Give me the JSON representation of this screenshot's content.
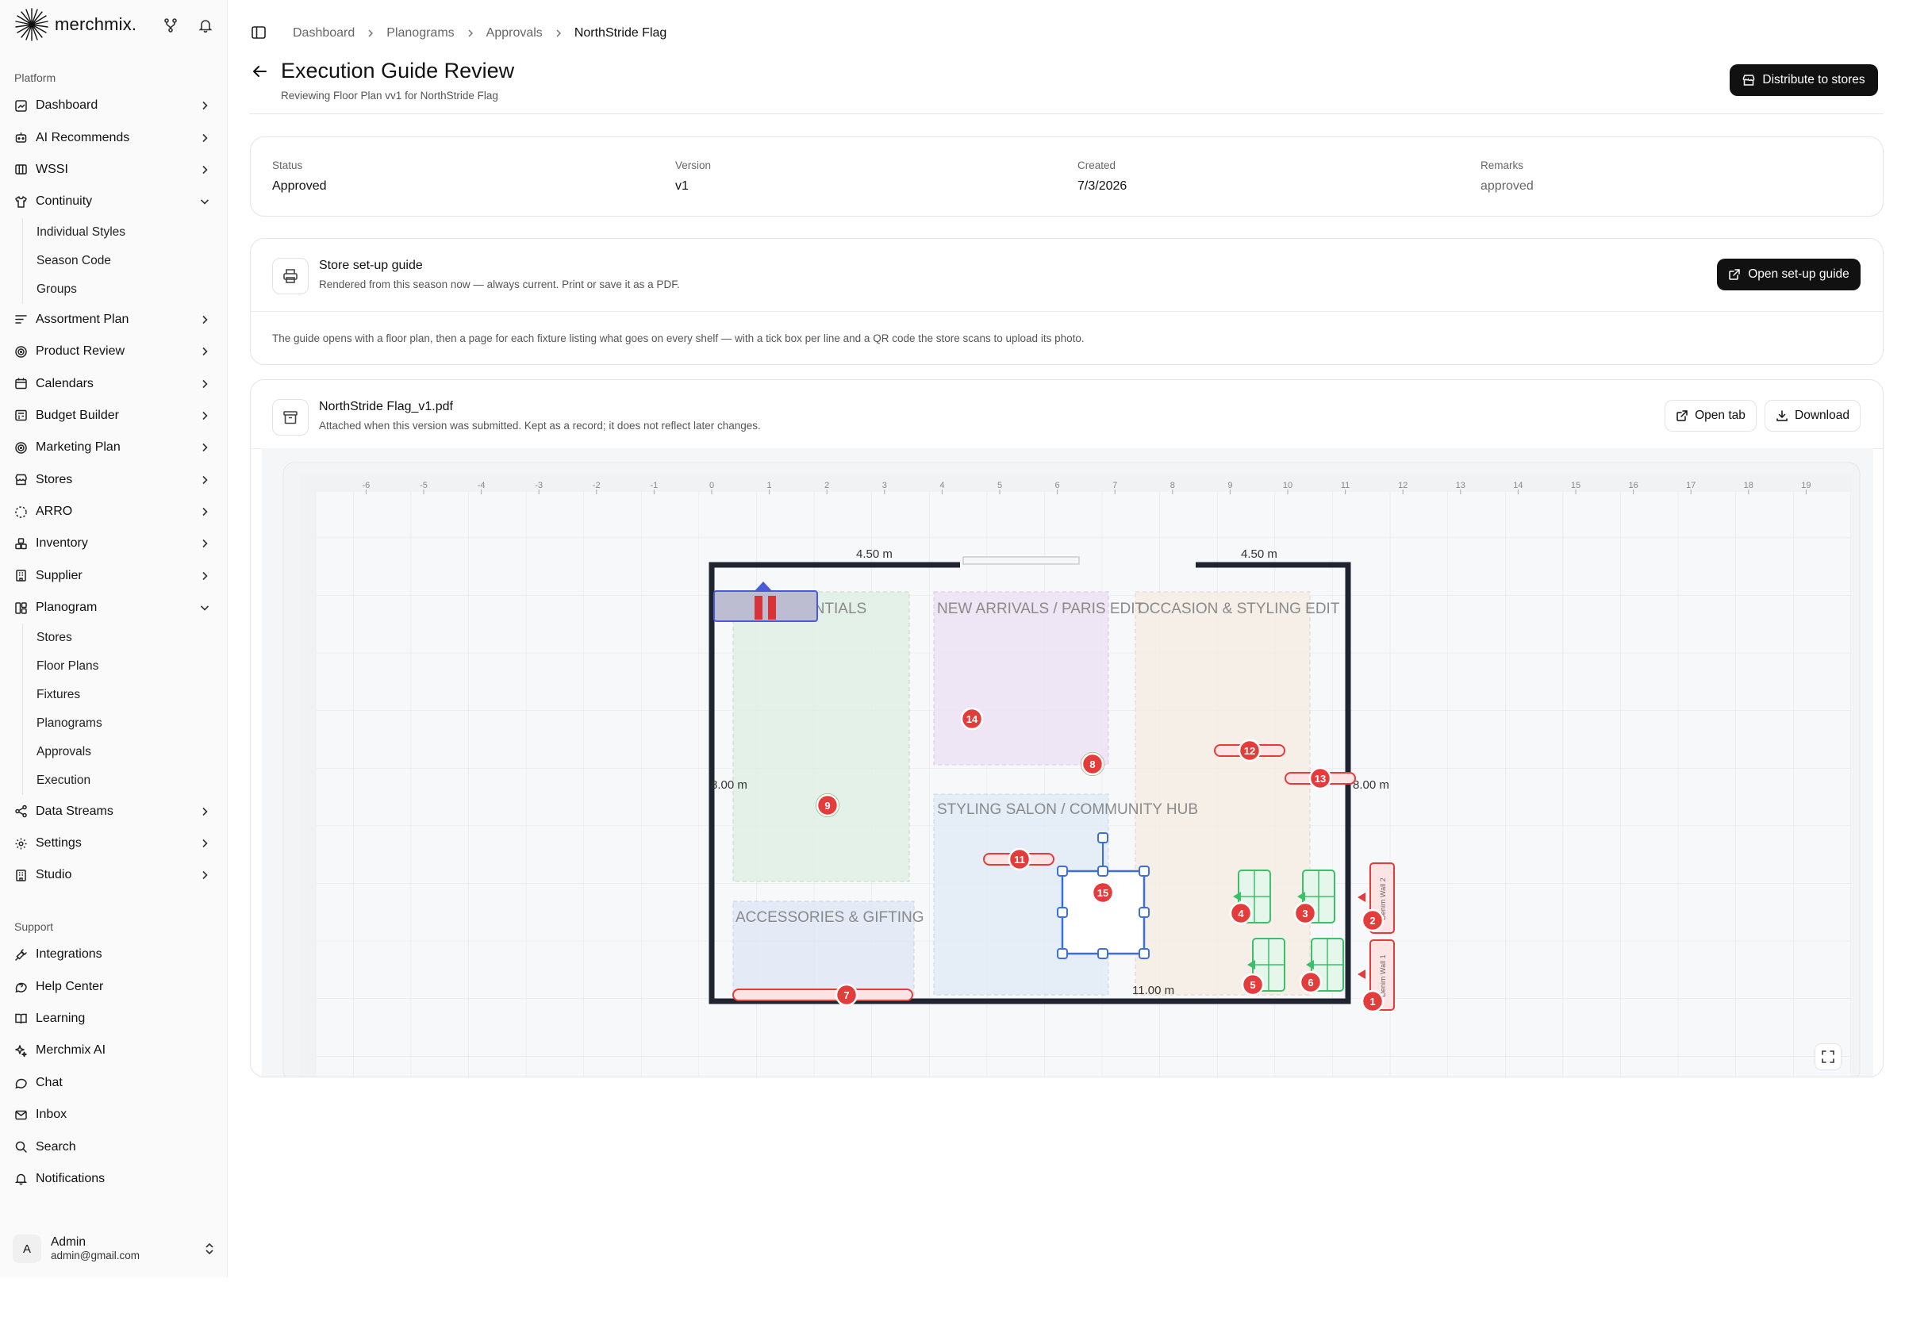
{
  "brand": {
    "name": "merchmix."
  },
  "sidebar": {
    "platform_label": "Platform",
    "items": [
      {
        "label": "Dashboard",
        "icon": "dashboard-icon",
        "expanded": false
      },
      {
        "label": "AI Recommends",
        "icon": "bot-icon",
        "expanded": false
      },
      {
        "label": "WSSI",
        "icon": "columns-icon",
        "expanded": false
      },
      {
        "label": "Continuity",
        "icon": "shirt-icon",
        "expanded": true
      },
      {
        "label": "Assortment Plan",
        "icon": "list-icon",
        "expanded": false
      },
      {
        "label": "Product Review",
        "icon": "target-icon",
        "expanded": false
      },
      {
        "label": "Calendars",
        "icon": "calendar-icon",
        "expanded": false
      },
      {
        "label": "Budget Builder",
        "icon": "calculator-icon",
        "expanded": false
      },
      {
        "label": "Marketing Plan",
        "icon": "target-icon",
        "expanded": false
      },
      {
        "label": "Stores",
        "icon": "store-icon",
        "expanded": false
      },
      {
        "label": "ARRO",
        "icon": "dashed-circle-icon",
        "expanded": false
      },
      {
        "label": "Inventory",
        "icon": "boxes-icon",
        "expanded": false
      },
      {
        "label": "Supplier",
        "icon": "building-icon",
        "expanded": false
      },
      {
        "label": "Planogram",
        "icon": "layout-icon",
        "expanded": true
      },
      {
        "label": "Data Streams",
        "icon": "share-icon",
        "expanded": false
      },
      {
        "label": "Settings",
        "icon": "gear-icon",
        "expanded": false
      },
      {
        "label": "Studio",
        "icon": "building-icon",
        "expanded": false
      }
    ],
    "continuity_children": [
      "Individual Styles",
      "Season Code",
      "Groups"
    ],
    "planogram_children": [
      "Stores",
      "Floor Plans",
      "Fixtures",
      "Planograms",
      "Approvals",
      "Execution"
    ],
    "support_label": "Support",
    "support_items": [
      {
        "label": "Integrations",
        "icon": "plug-icon"
      },
      {
        "label": "Help Center",
        "icon": "help-icon"
      },
      {
        "label": "Learning",
        "icon": "book-icon"
      },
      {
        "label": "Merchmix AI",
        "icon": "sparkle-icon"
      },
      {
        "label": "Chat",
        "icon": "chat-icon"
      },
      {
        "label": "Inbox",
        "icon": "mail-icon"
      },
      {
        "label": "Search",
        "icon": "search-icon"
      },
      {
        "label": "Notifications",
        "icon": "bell-icon"
      }
    ],
    "user": {
      "initial": "A",
      "name": "Admin",
      "email": "admin@gmail.com"
    }
  },
  "breadcrumb": [
    "Dashboard",
    "Planograms",
    "Approvals",
    "NorthStride Flag"
  ],
  "header": {
    "title": "Execution Guide Review",
    "subtitle": "Reviewing Floor Plan vv1 for NorthStride Flag",
    "distribute_label": "Distribute to stores"
  },
  "summary": {
    "status_label": "Status",
    "status": "Approved",
    "version_label": "Version",
    "version": "v1",
    "created_label": "Created",
    "created": "7/3/2026",
    "remarks_label": "Remarks",
    "remarks": "approved"
  },
  "guide": {
    "title": "Store set-up guide",
    "subtitle": "Rendered from this season now — always current. Print or save it as a PDF.",
    "open_label": "Open set-up guide",
    "note": "The guide opens with a floor plan, then a page for each fixture listing what goes on every shelf — with a tick box per line and a QR code the store scans to upload its photo."
  },
  "attachment": {
    "filename": "NorthStride Flag_v1.pdf",
    "subtitle": "Attached when this version was submitted. Kept as a record; it does not reflect later changes.",
    "open_tab_label": "Open tab",
    "download_label": "Download"
  },
  "floorplan": {
    "ruler": [
      "-6",
      "-5",
      "-4",
      "-3",
      "-2",
      "-1",
      "0",
      "1",
      "2",
      "3",
      "4",
      "5",
      "6",
      "7",
      "8",
      "9",
      "10",
      "11",
      "12",
      "13",
      "14",
      "15",
      "16",
      "17",
      "18",
      "19"
    ],
    "dimensions": {
      "top_left": "4.50 m",
      "top_right": "4.50 m",
      "left": "8.00 m",
      "right": "8.00 m",
      "bottom": "11.00 m"
    },
    "zones": [
      "ESSENTIALS",
      "NEW ARRIVALS / PARIS EDIT",
      "OCCASION & STYLING EDIT",
      "STYLING SALON / COMMUNITY HUB",
      "ACCESSORIES & GIFTING"
    ],
    "markers": [
      "1",
      "2",
      "3",
      "4",
      "5",
      "6",
      "7",
      "8",
      "9",
      "11",
      "12",
      "13",
      "14",
      "15"
    ],
    "fixture_labels": [
      "Denim Wall 2",
      "Denim Wall 1"
    ],
    "colors": {
      "marker": "#e43b3b",
      "selection": "#3b6fe0",
      "wall": "#1f2430",
      "fixture_green": "#3cbf6b"
    }
  }
}
